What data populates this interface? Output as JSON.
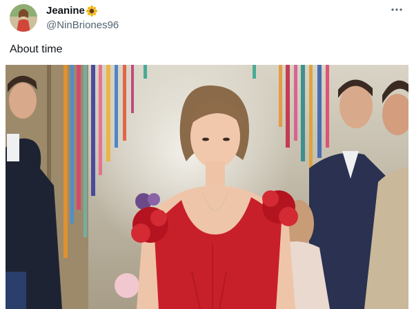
{
  "tweet": {
    "display_name": "Jeanine",
    "handle": "@NinBriones96",
    "text": "About time"
  },
  "icons": {
    "avatar": "profile-photo",
    "name_emoji": "sunflower-icon",
    "more": "more-options-icon"
  },
  "colors": {
    "text_primary": "#0f1419",
    "text_secondary": "#536471",
    "dress": "#c8202a"
  }
}
